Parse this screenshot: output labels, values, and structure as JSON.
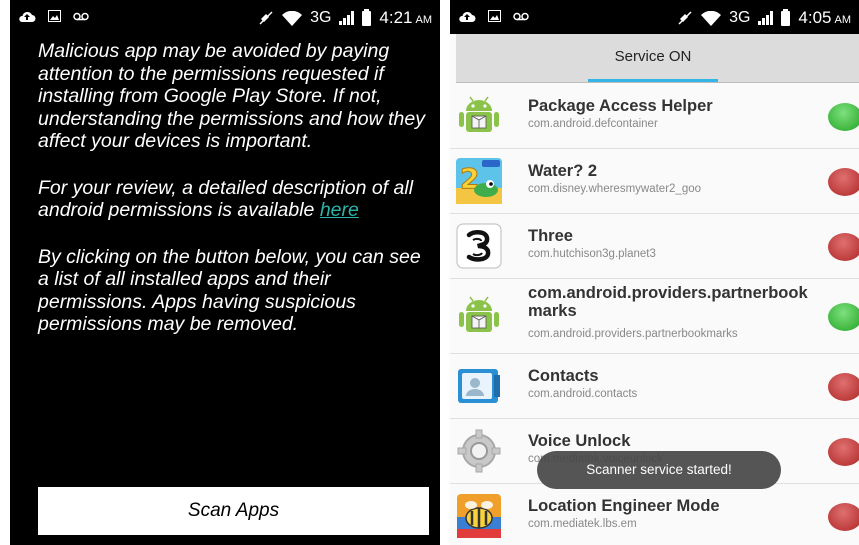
{
  "left_screen": {
    "status_bar": {
      "time": "4:21",
      "ampm": "AM",
      "network": "3G"
    },
    "paragraphs": [
      "Malicious app may be avoided by paying attention to the permissions requested if installing from Google Play Store. If not, understanding the permissions and how they affect your devices is important.",
      "By clicking on the button below, you can see a list of all installed apps and their permissions. Apps having suspicious permissions may be removed."
    ],
    "review_text": "For your review, a detailed description of all android permissions is available ",
    "review_link": "here",
    "scan_button": "Scan Apps"
  },
  "right_screen": {
    "status_bar": {
      "time": "4:05",
      "ampm": "AM",
      "network": "3G"
    },
    "tab_label": "Service ON",
    "apps": [
      {
        "name": "Package Access Helper",
        "package": "com.android.defcontainer",
        "icon": "android-icon",
        "status": "green"
      },
      {
        "name": "Water? 2",
        "package": "com.disney.wheresmywater2_goo",
        "icon": "water2-game-icon",
        "status": "red"
      },
      {
        "name": "Three",
        "package": "com.hutchison3g.planet3",
        "icon": "three-logo-icon",
        "status": "red"
      },
      {
        "name": "com.android.providers.partnerbookmarks",
        "package": "com.android.providers.partnerbookmarks",
        "icon": "android-icon",
        "status": "green"
      },
      {
        "name": "Contacts",
        "package": "com.android.contacts",
        "icon": "contacts-icon",
        "status": "red"
      },
      {
        "name": "Voice Unlock",
        "package": "com.mediatek.voiceunlock",
        "icon": "gear-icon",
        "status": "red"
      },
      {
        "name": "Location Engineer Mode",
        "package": "com.mediatek.lbs.em",
        "icon": "bee-icon",
        "status": "red"
      }
    ],
    "toast": "Scanner service started!"
  },
  "colors": {
    "link": "#2ab5a8",
    "tab_indicator": "#33b5e5",
    "status_green": "#3cb53c",
    "status_red": "#bc3a3a"
  }
}
